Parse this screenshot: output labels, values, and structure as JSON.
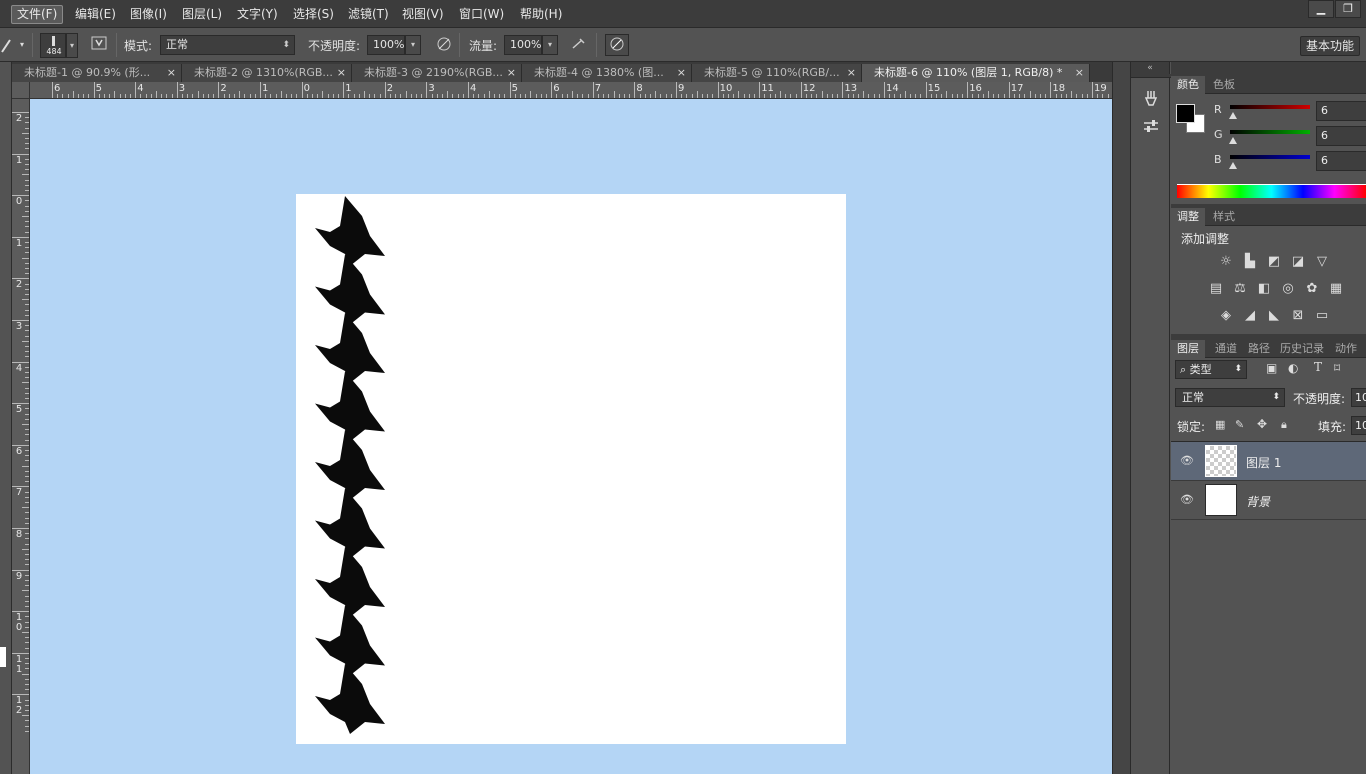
{
  "menu": {
    "items": [
      "文件(F)",
      "编辑(E)",
      "图像(I)",
      "图层(L)",
      "文字(Y)",
      "选择(S)",
      "滤镜(T)",
      "视图(V)",
      "窗口(W)",
      "帮助(H)"
    ],
    "active_index": 0
  },
  "window_controls": [
    "minimize-icon",
    "restore-icon"
  ],
  "options_bar": {
    "brush_size": "484",
    "mode_label": "模式:",
    "mode_value": "正常",
    "opacity_label": "不透明度:",
    "opacity_value": "100%",
    "flow_label": "流量:",
    "flow_value": "100%",
    "workspace": "基本功能"
  },
  "tabs": [
    {
      "label": "未标题-1 @ 90.9% (形...",
      "active": false
    },
    {
      "label": "未标题-2 @ 1310%(RGB...",
      "active": false
    },
    {
      "label": "未标题-3 @ 2190%(RGB...",
      "active": false
    },
    {
      "label": "未标题-4 @ 1380% (图...",
      "active": false
    },
    {
      "label": "未标题-5 @ 110%(RGB/...",
      "active": false
    },
    {
      "label": "未标题-6 @ 110% (图层 1, RGB/8) *",
      "active": true
    }
  ],
  "tab_close_glyph": "×",
  "ruler": {
    "horizontal_labels": [
      "6",
      "5",
      "4",
      "3",
      "2",
      "1",
      "0",
      "1",
      "2",
      "3",
      "4",
      "5",
      "6",
      "7",
      "8",
      "9",
      "10",
      "11",
      "12",
      "13",
      "14",
      "15",
      "16",
      "17",
      "18",
      "19"
    ],
    "vertical_labels": [
      "2",
      "1",
      "0",
      "1",
      "2",
      "3",
      "4",
      "5",
      "6",
      "7",
      "8",
      "9",
      "1 0",
      "1 1",
      "1 2"
    ]
  },
  "canvas": {
    "background_color": "#b4d5f5",
    "document_color": "#ffffff",
    "pattern_color": "#0b0b0b",
    "pattern": "houndstooth-column"
  },
  "color_panel": {
    "tabs": [
      "颜色",
      "色板"
    ],
    "channels": [
      {
        "label": "R",
        "value": "6",
        "color": "#d00000"
      },
      {
        "label": "G",
        "value": "6",
        "color": "#00b000"
      },
      {
        "label": "B",
        "value": "6",
        "color": "#0000d0"
      }
    ],
    "foreground": "#000000",
    "background": "#ffffff"
  },
  "adjustments_panel": {
    "tabs": [
      "调整",
      "样式"
    ],
    "title": "添加调整",
    "icons": [
      "brightness-icon",
      "levels-icon",
      "curves-icon",
      "exposure-icon",
      "vibrance-icon",
      "hue-saturation-icon",
      "color-balance-icon",
      "black-white-icon",
      "photo-filter-icon",
      "channel-mixer-icon",
      "color-lookup-icon",
      "invert-icon",
      "posterize-icon",
      "threshold-icon",
      "selective-color-icon",
      "gradient-map-icon"
    ]
  },
  "layers_panel": {
    "tabs": [
      "图层",
      "通道",
      "路径",
      "历史记录",
      "动作"
    ],
    "filter_label": "类型",
    "blend_mode": "正常",
    "opacity_label": "不透明度:",
    "opacity_value": "10",
    "lock_label": "锁定:",
    "fill_label": "填充:",
    "fill_value": "10",
    "layers": [
      {
        "name": "图层 1",
        "selected": true,
        "transparent": true
      },
      {
        "name": "背景",
        "selected": false,
        "transparent": false
      }
    ]
  }
}
